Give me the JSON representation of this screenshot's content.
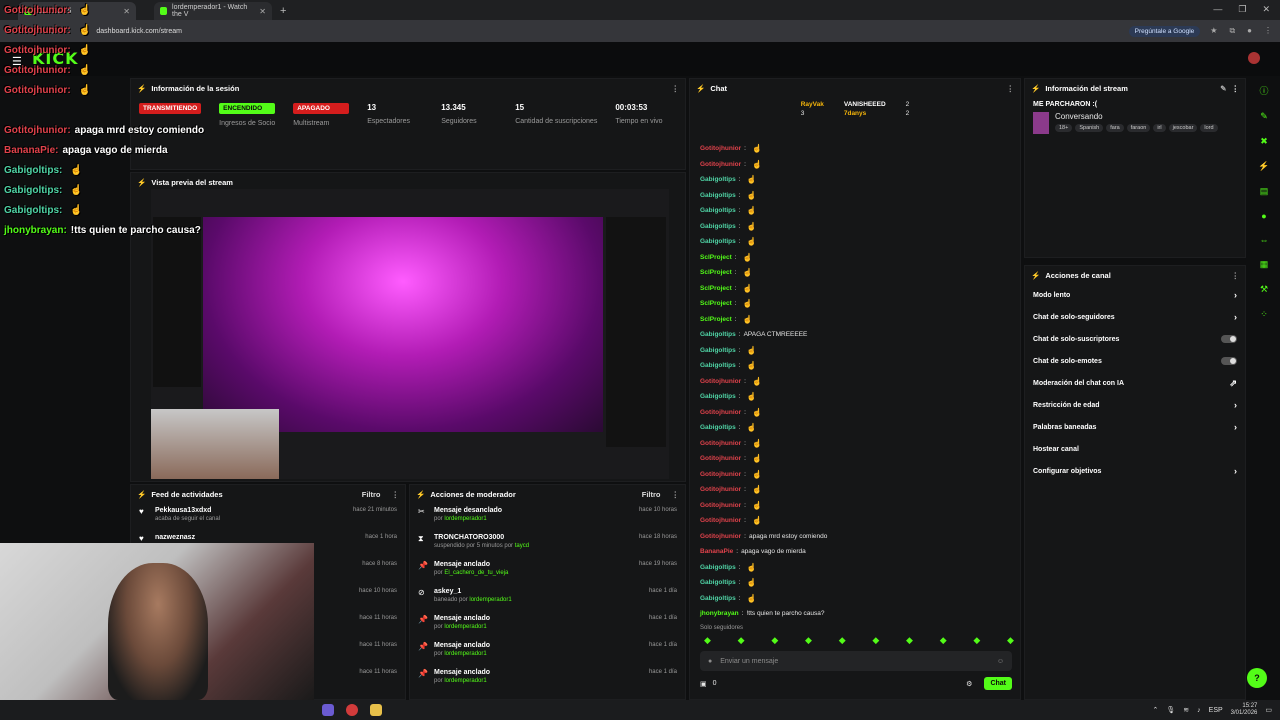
{
  "browser": {
    "tabs": [
      {
        "label": "Dashboard",
        "active": true
      },
      {
        "label": "lordemperador1 - Watch the V",
        "active": false
      }
    ],
    "url": "dashboard.kick.com/stream",
    "google_button": "Pregúntale a Google"
  },
  "kick": {
    "logo": "KICK"
  },
  "session": {
    "title": "Información de la sesión",
    "stats": [
      {
        "badge": "TRANSMITIENDO",
        "badge_color": "#d51d1d",
        "label": ""
      },
      {
        "badge": "ENCENDIDO",
        "badge_color": "#53fc18",
        "label": "Ingresos de Socio"
      },
      {
        "badge": "APAGADO",
        "badge_color": "#d51d1d",
        "label": "Multistream"
      },
      {
        "value": "13",
        "label": "Espectadores"
      },
      {
        "value": "13.345",
        "label": "Seguidores"
      },
      {
        "value": "15",
        "label": "Cantidad de suscripciones"
      },
      {
        "value": "00:03:53",
        "label": "Tiempo en vivo"
      }
    ]
  },
  "preview": {
    "title": "Vista previa del stream"
  },
  "activity_feed": {
    "title": "Feed de actividades",
    "filter": "Filtro",
    "items": [
      {
        "icon": "heart-icon",
        "title": "Pekkausa13xdxd",
        "sub": "acaba de seguir el canal",
        "time": "hace 21 minutos"
      },
      {
        "icon": "heart-icon",
        "title": "nazweznasz",
        "sub": "",
        "time": "hace 1 hora"
      },
      {
        "icon": "",
        "title": "",
        "sub": "",
        "time": "hace 8 horas"
      },
      {
        "icon": "",
        "title": "",
        "sub": "",
        "time": "hace 10 horas"
      },
      {
        "icon": "",
        "title": "",
        "sub": "",
        "time": "hace 11 horas"
      },
      {
        "icon": "",
        "title": "",
        "sub": "",
        "time": "hace 11 horas"
      },
      {
        "icon": "",
        "title": "",
        "sub": "",
        "time": "hace 11 horas"
      }
    ]
  },
  "mod_actions": {
    "title": "Acciones de moderador",
    "filter": "Filtro",
    "items": [
      {
        "icon": "unpin-icon",
        "title": "Mensaje desanclado",
        "sub_prefix": "por ",
        "sub_user": "lordemperador1",
        "time": "hace 10 horas"
      },
      {
        "icon": "hourglass-icon",
        "title": "TRONCHATORO3000",
        "sub_prefix": "suspendido por 5 minutos por ",
        "sub_user": "taycd",
        "time": "hace 18 horas"
      },
      {
        "icon": "pin-icon",
        "title": "Mensaje anclado",
        "sub_prefix": "por ",
        "sub_user": "El_cachero_de_tu_vieja",
        "time": "hace 19 horas"
      },
      {
        "icon": "ban-icon",
        "title": "askey_1",
        "sub_prefix": "baneado por ",
        "sub_user": "lordemperador1",
        "time": "hace 1 día"
      },
      {
        "icon": "pin-icon",
        "title": "Mensaje anclado",
        "sub_prefix": "por ",
        "sub_user": "lordemperador1",
        "time": "hace 1 día"
      },
      {
        "icon": "pin-icon",
        "title": "Mensaje anclado",
        "sub_prefix": "por ",
        "sub_user": "lordemperador1",
        "time": "hace 1 día"
      },
      {
        "icon": "pin-icon",
        "title": "Mensaje anclado",
        "sub_prefix": "por ",
        "sub_user": "lordemperador1",
        "time": "hace 1 día"
      }
    ]
  },
  "chat": {
    "title": "Chat",
    "top": [
      {
        "user": "RayVak",
        "count": "3"
      },
      {
        "user": "VANISHEEED",
        "count": "2"
      },
      {
        "user": "7danys",
        "count": "2"
      }
    ],
    "messages": [
      {
        "user": "Gotitojhunior",
        "color": "#e0424b",
        "text": ""
      },
      {
        "user": "Gotitojhunior",
        "color": "#e0424b",
        "text": ""
      },
      {
        "user": "Gabigoltips",
        "color": "#4fd3a5",
        "text": ""
      },
      {
        "user": "Gabigoltips",
        "color": "#4fd3a5",
        "text": ""
      },
      {
        "user": "Gabigoltips",
        "color": "#4fd3a5",
        "text": ""
      },
      {
        "user": "Gabigoltips",
        "color": "#4fd3a5",
        "text": ""
      },
      {
        "user": "Gabigoltips",
        "color": "#4fd3a5",
        "text": ""
      },
      {
        "user": "SclProject",
        "color": "#53fc18",
        "text": ""
      },
      {
        "user": "SclProject",
        "color": "#53fc18",
        "text": ""
      },
      {
        "user": "SclProject",
        "color": "#53fc18",
        "text": ""
      },
      {
        "user": "SclProject",
        "color": "#53fc18",
        "text": ""
      },
      {
        "user": "SclProject",
        "color": "#53fc18",
        "text": ""
      },
      {
        "user": "Gabigoltips",
        "color": "#4fd3a5",
        "text": "APAGA CTMREEEEE"
      },
      {
        "user": "Gabigoltips",
        "color": "#4fd3a5",
        "text": ""
      },
      {
        "user": "Gabigoltips",
        "color": "#4fd3a5",
        "text": ""
      },
      {
        "user": "Gotitojhunior",
        "color": "#e0424b",
        "text": ""
      },
      {
        "user": "Gabigoltips",
        "color": "#4fd3a5",
        "text": ""
      },
      {
        "user": "Gotitojhunior",
        "color": "#e0424b",
        "text": ""
      },
      {
        "user": "Gabigoltips",
        "color": "#4fd3a5",
        "text": ""
      },
      {
        "user": "Gotitojhunior",
        "color": "#e0424b",
        "text": ""
      },
      {
        "user": "Gotitojhunior",
        "color": "#e0424b",
        "text": ""
      },
      {
        "user": "Gotitojhunior",
        "color": "#e0424b",
        "text": ""
      },
      {
        "user": "Gotitojhunior",
        "color": "#e0424b",
        "text": ""
      },
      {
        "user": "Gotitojhunior",
        "color": "#e0424b",
        "text": ""
      },
      {
        "user": "Gotitojhunior",
        "color": "#e0424b",
        "text": ""
      },
      {
        "user": "Gotitojhunior",
        "color": "#e0424b",
        "text": "apaga mrd estoy comiendo"
      },
      {
        "user": "BananaPie",
        "color": "#e0424b",
        "text": "apaga vago de mierda"
      },
      {
        "user": "Gabigoltips",
        "color": "#4fd3a5",
        "text": ""
      },
      {
        "user": "Gabigoltips",
        "color": "#4fd3a5",
        "text": ""
      },
      {
        "user": "Gabigoltips",
        "color": "#4fd3a5",
        "text": ""
      },
      {
        "user": "jhonybrayan",
        "color": "#53fc18",
        "text": "!tts quien te parcho causa?"
      }
    ],
    "followers_only": "Solo seguidores",
    "input_placeholder": "Enviar un mensaje",
    "count": "0",
    "send_label": "Chat"
  },
  "stream_info": {
    "title": "Información del stream",
    "stream_title": "ME PARCHARON :(",
    "category": "Conversando",
    "tags": [
      "18+",
      "Spanish",
      "fara",
      "faraon",
      "irl",
      "jescobar",
      "lord"
    ]
  },
  "channel_actions": {
    "title": "Acciones de canal",
    "items": [
      {
        "label": "Modo lento",
        "control": "chevron"
      },
      {
        "label": "Chat de solo-seguidores",
        "control": "chevron"
      },
      {
        "label": "Chat de solo-suscriptores",
        "control": "toggle"
      },
      {
        "label": "Chat de solo-emotes",
        "control": "toggle"
      },
      {
        "label": "Moderación del chat con IA",
        "control": "external"
      },
      {
        "label": "Restricción de edad",
        "control": "chevron"
      },
      {
        "label": "Palabras baneadas",
        "control": "chevron"
      },
      {
        "label": "Hostear canal",
        "control": "none"
      },
      {
        "label": "Configurar objetivos",
        "control": "chevron"
      }
    ]
  },
  "overlay": [
    {
      "user": "Gotitojhunior:",
      "color": "#e0424b",
      "text": ""
    },
    {
      "user": "Gotitojhunior:",
      "color": "#e0424b",
      "text": ""
    },
    {
      "user": "Gotitojhunior:",
      "color": "#e0424b",
      "text": ""
    },
    {
      "user": "Gotitojhunior:",
      "color": "#e0424b",
      "text": ""
    },
    {
      "user": "Gotitojhunior:",
      "color": "#e0424b",
      "text": ""
    },
    {
      "user": "Gotitojhunior:",
      "color": "#e0424b",
      "text": "apaga mrd estoy comiendo"
    },
    {
      "user": "BananaPie:",
      "color": "#e0424b",
      "text": "apaga vago de mierda"
    },
    {
      "user": "Gabigoltips:",
      "color": "#4fd3a5",
      "text": ""
    },
    {
      "user": "Gabigoltips:",
      "color": "#4fd3a5",
      "text": ""
    },
    {
      "user": "Gabigoltips:",
      "color": "#4fd3a5",
      "text": ""
    },
    {
      "user": "jhonybrayan:",
      "color": "#53fc18",
      "text": "!tts quien te parcho causa?"
    }
  ],
  "sidebar": {
    "menu_item": "Información de la sesión"
  },
  "taskbar": {
    "lang": "ESP",
    "time": "15:27",
    "date": "3/01/2026"
  },
  "colors": {
    "kick_green": "#53fc18",
    "live_red": "#d51d1d"
  }
}
